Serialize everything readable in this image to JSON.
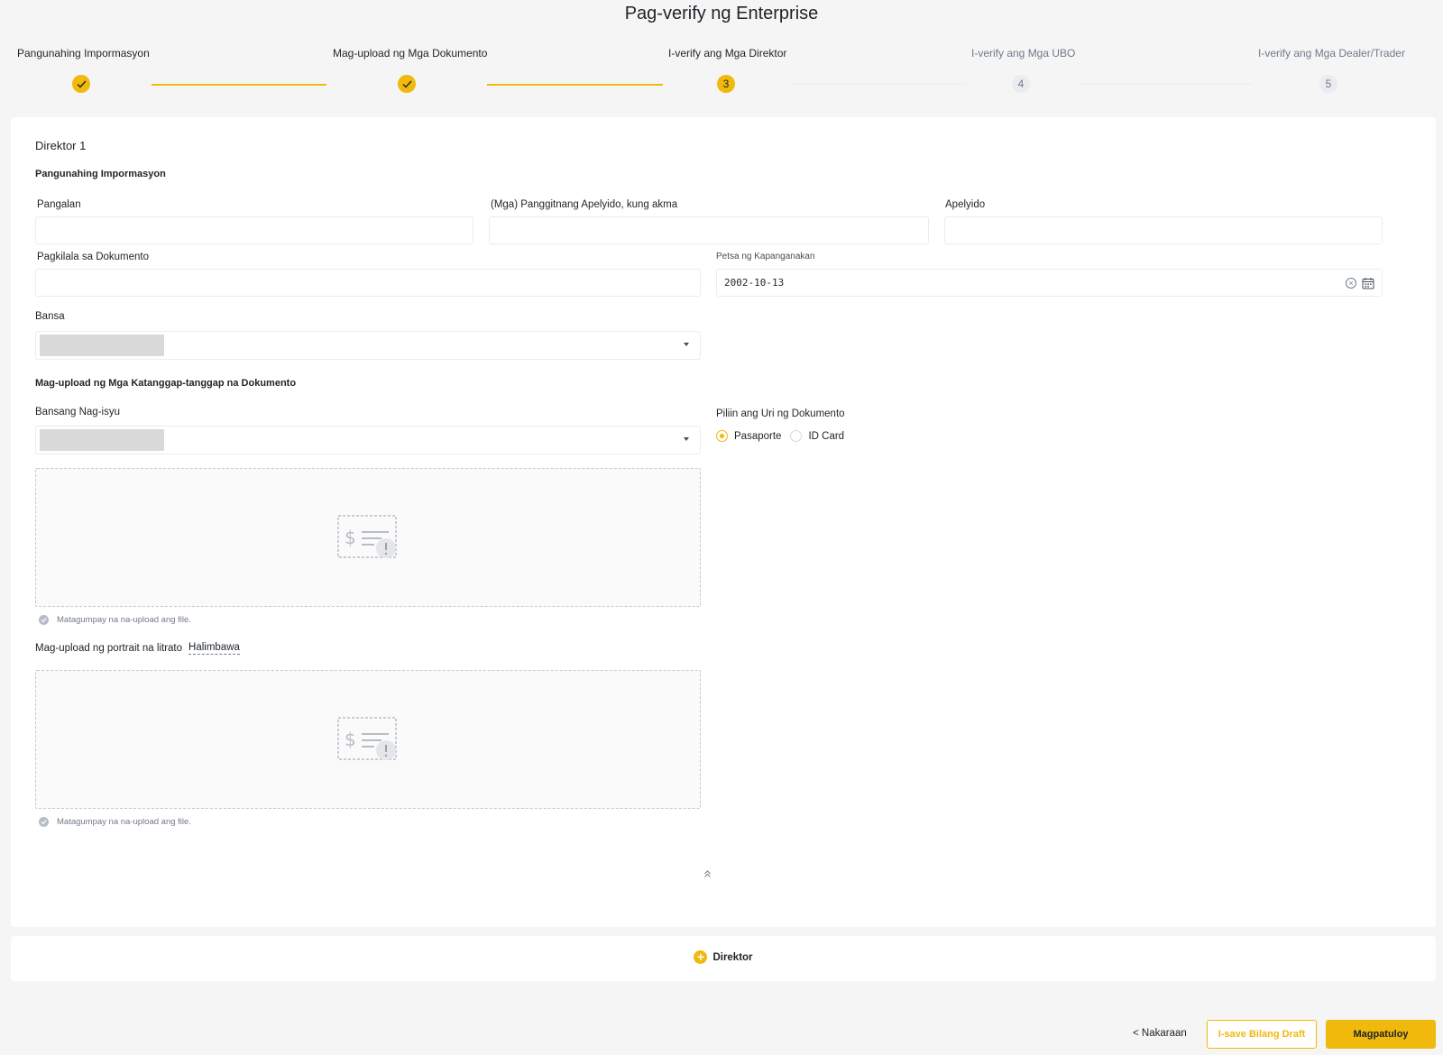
{
  "page": {
    "title": "Pag-verify ng Enterprise"
  },
  "stepper": {
    "steps": [
      {
        "label": "Pangunahing Impormasyon",
        "status": "done",
        "number": "1"
      },
      {
        "label": "Mag-upload ng Mga Dokumento",
        "status": "done",
        "number": "2"
      },
      {
        "label": "I-verify ang Mga Direktor",
        "status": "active",
        "number": "3"
      },
      {
        "label": "I-verify ang Mga UBO",
        "status": "pending",
        "number": "4"
      },
      {
        "label": "I-verify ang Mga Dealer/Trader",
        "status": "pending",
        "number": "5"
      }
    ]
  },
  "director": {
    "title": "Direktor 1",
    "basic_info_title": "Pangunahing Impormasyon",
    "fields": {
      "first_name": {
        "label": "Pangalan",
        "value": ""
      },
      "middle_name": {
        "label": "(Mga) Panggitnang Apelyido, kung akma",
        "value": ""
      },
      "last_name": {
        "label": "Apelyido",
        "value": ""
      },
      "document_id": {
        "label": "Pagkilala sa Dokumento",
        "value": ""
      },
      "birth_date": {
        "label": "Petsa ng Kapanganakan",
        "value": "2002-10-13"
      },
      "country": {
        "label": "Bansa",
        "value": ""
      }
    },
    "upload_section": {
      "title": "Mag-upload ng Mga Katanggap-tanggap na Dokumento",
      "issuing_country_label": "Bansang Nag-isyu",
      "doc_type_label": "Piliin ang Uri ng Dokumento",
      "doc_types": [
        "Pasaporte",
        "ID Card"
      ],
      "selected_doc_type": "Pasaporte",
      "upload_success": "Matagumpay na na-upload ang file.",
      "portrait_label": "Mag-upload ng portrait na litrato",
      "example_link": "Halimbawa"
    }
  },
  "add_director": {
    "label": "Direktor"
  },
  "footer": {
    "prev_label": "< Nakaraan",
    "draft_label": "I-save Bilang Draft",
    "continue_label": "Magpatuloy"
  },
  "colors": {
    "accent": "#f0b90b",
    "border": "#eaecef",
    "text": "#1e2329",
    "muted": "#707a8a"
  },
  "icons": [
    "check-icon",
    "calendar-icon",
    "clear-icon",
    "chevron-down-icon",
    "document-upload-icon",
    "success-icon",
    "collapse-up-icon",
    "plus-icon"
  ]
}
